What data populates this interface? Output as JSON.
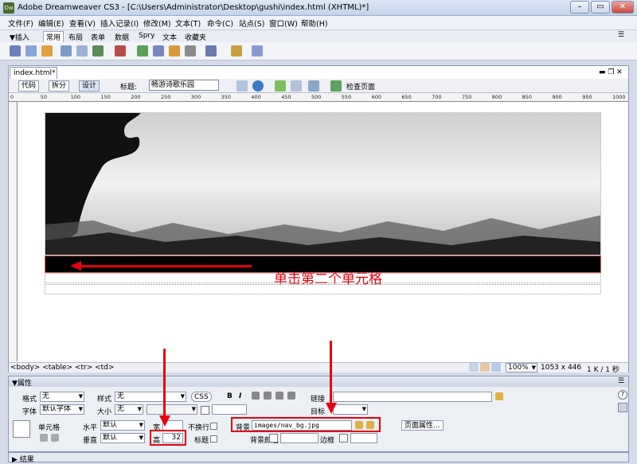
{
  "window": {
    "app_icon": "Dw",
    "title": "Adobe Dreamweaver CS3 - [C:\\Users\\Administrator\\Desktop\\gushi\\index.html (XHTML)*]"
  },
  "menu": [
    "文件(F)",
    "编辑(E)",
    "查看(V)",
    "插入记录(I)",
    "修改(M)",
    "文本(T)",
    "命令(C)",
    "站点(S)",
    "窗口(W)",
    "帮助(H)"
  ],
  "insert_tabs": [
    "▼插入",
    "常用",
    "布局",
    "表单",
    "数据",
    "Spry",
    "文本",
    "收藏夹"
  ],
  "document": {
    "tab_name": "index.html*",
    "view_code": "代码",
    "view_split": "拆分",
    "view_design": "设计",
    "title_label": "标题:",
    "title_value": "畅游诗歌乐园",
    "check_page": "检查页面"
  },
  "ruler": [
    "0",
    "50",
    "100",
    "150",
    "200",
    "250",
    "300",
    "350",
    "400",
    "450",
    "500",
    "550",
    "600",
    "650",
    "700",
    "750",
    "800",
    "850",
    "900",
    "950",
    "1000"
  ],
  "annotation": "单击第二个单元格",
  "status": {
    "tag_path": "<body> <table> <tr> <td>",
    "zoom": "100%",
    "dims": "1053 x 446",
    "size": "1 K / 1 秒"
  },
  "properties": {
    "header": "▼属性",
    "format_label": "格式",
    "format_value": "无",
    "style_label": "样式",
    "style_value": "无",
    "css_button": "CSS",
    "bold": "B",
    "italic": "I",
    "link_label": "链接",
    "font_label": "字体",
    "font_value": "默认字体",
    "size_label": "大小",
    "size_value": "无",
    "target_label": "目标",
    "cell_label": "单元格",
    "horz_label": "水平",
    "horz_value": "默认",
    "vert_label": "垂直",
    "vert_value": "默认",
    "width_label": "宽",
    "width_value": "",
    "height_label": "高",
    "height_value": "32",
    "nowrap_label": "不换行",
    "header_label": "标题",
    "bg_label": "背景",
    "bg_value": "images/nav_bg.jpg",
    "bgcolor_label": "背景颜色",
    "border_label": "边框",
    "page_props": "页面属性..."
  },
  "footer": "▶ 结果",
  "colors": {
    "annotation": "#e60012",
    "nav_row": "#000000"
  }
}
